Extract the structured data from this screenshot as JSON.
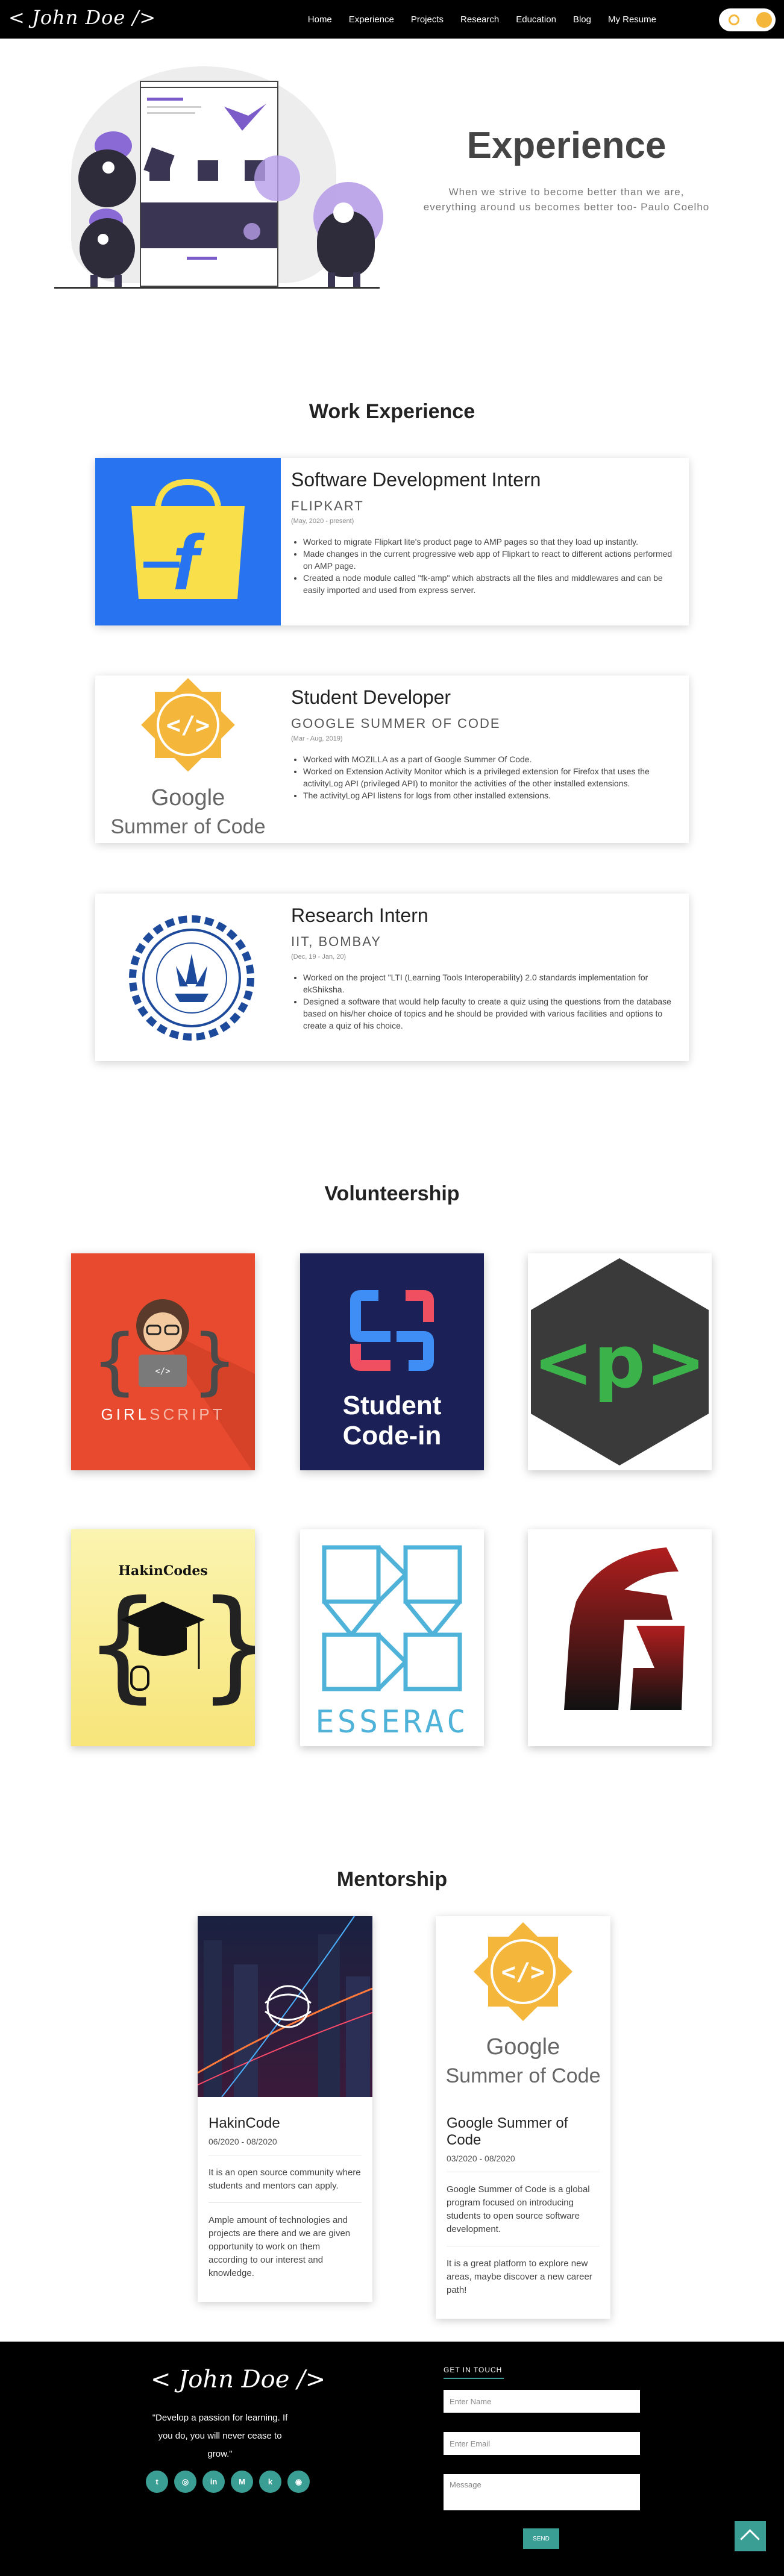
{
  "brand": {
    "logo": "< John Doe />"
  },
  "nav": {
    "links": [
      "Home",
      "Experience",
      "Projects",
      "Research",
      "Education",
      "Blog",
      "My Resume"
    ]
  },
  "hero": {
    "title": "Experience",
    "quote": "When we strive to become better than we are, everything around us becomes better too- Paulo Coelho"
  },
  "sections": {
    "work": "Work Experience",
    "volunteer": "Volunteership",
    "mentorship": "Mentorship"
  },
  "experience": [
    {
      "role": "Software Development Intern",
      "org": "FLIPKART",
      "dates": "(May, 2020 - present)",
      "points": [
        "Worked to migrate Flipkart lite's product page to AMP pages so that they load up instantly.",
        "Made changes in the current progressive web app of Flipkart to react to different actions performed on AMP page.",
        "Created a node module called \"fk-amp\" which abstracts all the files and middlewares and can be easily imported and used from express server."
      ]
    },
    {
      "role": "Student Developer",
      "org": "GOOGLE SUMMER OF CODE",
      "dates": "(Mar - Aug, 2019)",
      "logo_text_1": "Google",
      "logo_text_2": "Summer of Code",
      "points": [
        "Worked with MOZILLA as a part of Google Summer Of Code.",
        "Worked on Extension Activity Monitor which is a privileged extension for Firefox that uses the activityLog API (privileged API) to monitor the activities of the other installed extensions.",
        "The activityLog API listens for logs from other installed extensions."
      ]
    },
    {
      "role": "Research Intern",
      "org": "IIT, BOMBAY",
      "dates": "(Dec, 19 - Jan, 20)",
      "points": [
        "Worked on the project \"LTI (Learning Tools Interoperability) 2.0 standards implementation for ekShiksha.",
        "Designed a software that would help faculty to create a quiz using the questions from the database based on his/her choice of topics and he should be provided with various facilities and options to create a quiz of his choice."
      ]
    }
  ],
  "volunteer_tiles": {
    "girlscript_a": "GIRL",
    "girlscript_b": "SCRIPT",
    "codein_1": "Student",
    "codein_2": "Code-in",
    "hakin": "HakinCodes",
    "tesserac": "ESSERAC"
  },
  "mentorship": [
    {
      "name": "HakinCode",
      "dates": "06/2020 - 08/2020",
      "paras": [
        "It is an open source community where students and mentors can apply.",
        "Ample amount of technologies and projects are there and we are given opportunity to work on them according to our interest and knowledge."
      ]
    },
    {
      "name": "Google Summer of Code",
      "dates": "03/2020 - 08/2020",
      "logo_text_1": "Google",
      "logo_text_2": "Summer of Code",
      "paras": [
        "Google Summer of Code is a global program focused on introducing students to open source software development.",
        "It is a great platform to explore new areas, maybe discover a new career path!"
      ]
    }
  ],
  "footer": {
    "logo": "< John Doe />",
    "quote": "\"Develop a passion for learning. If you do, you will never cease to grow.\"",
    "socials": [
      "twitter-icon",
      "dribbble-icon",
      "linkedin-icon",
      "medium-icon",
      "kaggle-icon",
      "github-icon"
    ],
    "social_glyphs": [
      "t",
      "◎",
      "in",
      "M",
      "k",
      "◉"
    ],
    "contact_title": "GET IN TOUCH",
    "name_placeholder": "Enter Name",
    "email_placeholder": "Enter Email",
    "message_placeholder": "Message",
    "send_label": "SEND"
  },
  "colors": {
    "accent": "#3a9e95",
    "hero_purple": "#8a6bd6",
    "flipkart_blue": "#2874f0",
    "gsoc_yellow": "#f5b73b",
    "girlscript_red": "#e84a2f",
    "codein_navy": "#1b2057"
  }
}
